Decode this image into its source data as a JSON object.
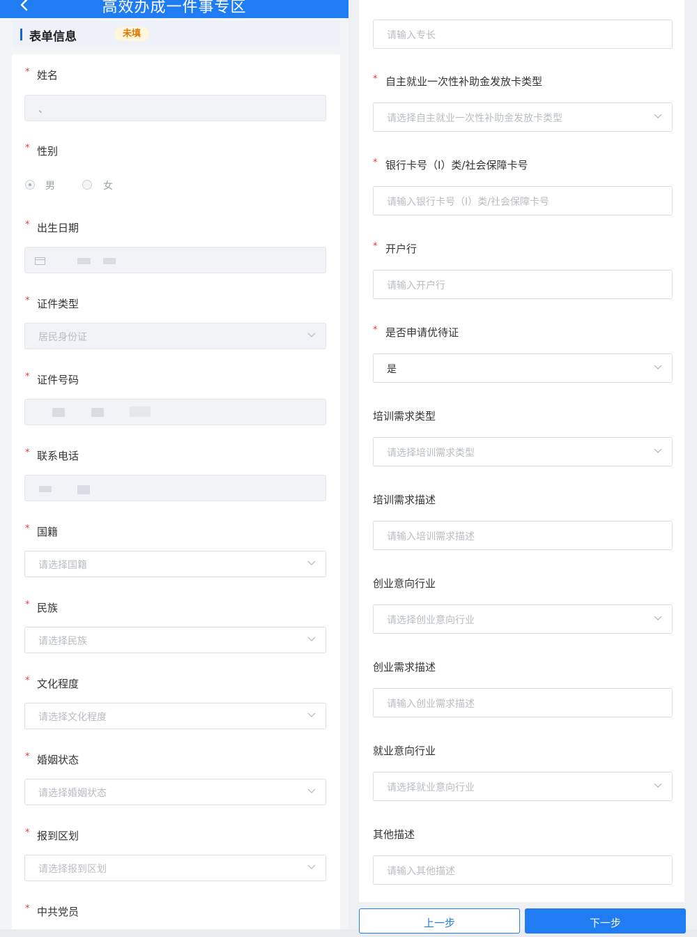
{
  "header": {
    "title": "高效办成一件事专区"
  },
  "section": {
    "title": "表单信息",
    "badge": "未填"
  },
  "left": {
    "name": {
      "label": "姓名",
      "value": "、"
    },
    "gender": {
      "label": "性别",
      "options": [
        "男",
        "女"
      ],
      "selected": "男"
    },
    "birth": {
      "label": "出生日期"
    },
    "id_type": {
      "label": "证件类型",
      "value": "居民身份证"
    },
    "id_number": {
      "label": "证件号码"
    },
    "phone": {
      "label": "联系电话"
    },
    "nationality": {
      "label": "国籍",
      "placeholder": "请选择国籍"
    },
    "ethnicity": {
      "label": "民族",
      "placeholder": "请选择民族"
    },
    "education": {
      "label": "文化程度",
      "placeholder": "请选择文化程度"
    },
    "marital": {
      "label": "婚姻状态",
      "placeholder": "请选择婚姻状态"
    },
    "district": {
      "label": "报到区划",
      "placeholder": "请选择报到区划"
    },
    "party": {
      "label": "中共党员"
    }
  },
  "right": {
    "specialty": {
      "placeholder": "请输入专长"
    },
    "card_type": {
      "label": "自主就业一次性补助金发放卡类型",
      "placeholder": "请选择自主就业一次性补助金发放卡类型"
    },
    "bank_card": {
      "label": "银行卡号（I）类/社会保障卡号",
      "placeholder": "请输入银行卡号（I）类/社会保障卡号"
    },
    "bank": {
      "label": "开户行",
      "placeholder": "请输入开户行"
    },
    "preferential": {
      "label": "是否申请优待证",
      "value": "是"
    },
    "training_type": {
      "label": "培训需求类型",
      "placeholder": "请选择培训需求类型"
    },
    "training_desc": {
      "label": "培训需求描述",
      "placeholder": "请输入培训需求描述"
    },
    "startup_industry": {
      "label": "创业意向行业",
      "placeholder": "请选择创业意向行业"
    },
    "startup_desc": {
      "label": "创业需求描述",
      "placeholder": "请输入创业需求描述"
    },
    "job_industry": {
      "label": "就业意向行业",
      "placeholder": "请选择就业意向行业"
    },
    "other_desc": {
      "label": "其他描述",
      "placeholder": "请输入其他描述"
    }
  },
  "buttons": {
    "prev": "上一步",
    "next": "下一步"
  },
  "colors": {
    "primary": "#1f7cf2",
    "required": "#e23b3b",
    "badge_text": "#d97a00"
  }
}
